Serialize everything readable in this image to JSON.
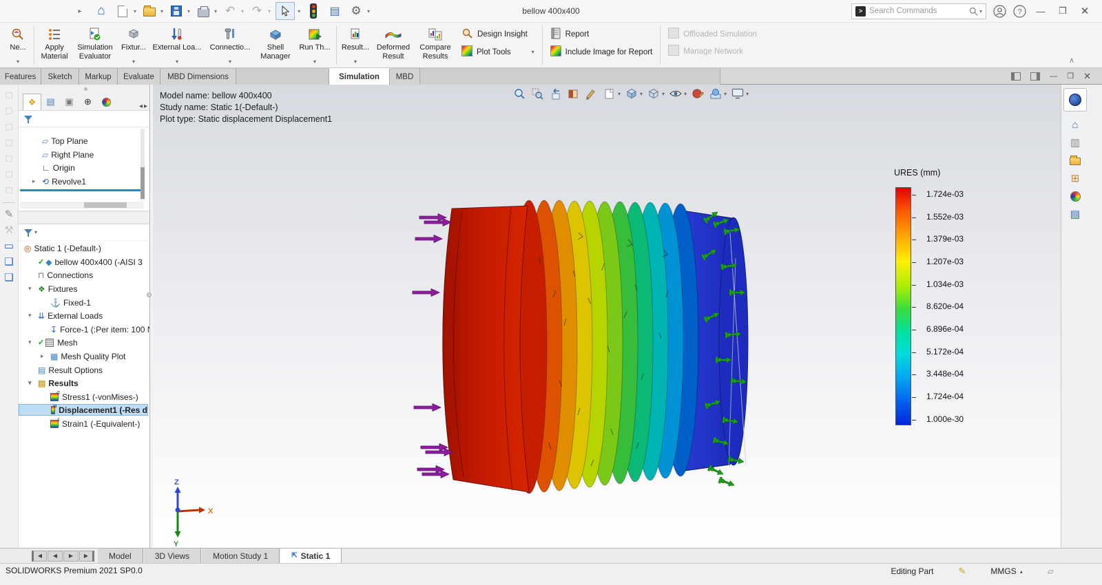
{
  "app": {
    "document_title": "bellow 400x400",
    "search_placeholder": "Search Commands",
    "status_left": "SOLIDWORKS Premium 2021 SP0.0",
    "status_editing": "Editing Part",
    "status_units": "MMGS"
  },
  "ribbon": {
    "new_study": "Ne...",
    "apply_material": "Apply Material",
    "simulation_evaluator": "Simulation Evaluator",
    "fixtures_advisor": "Fixtur...",
    "external_loads_advisor": "External Loa...",
    "connections_advisor": "Connectio...",
    "shell_manager": "Shell Manager",
    "run_study": "Run Th...",
    "results_advisor": "Result...",
    "deformed_result": "Deformed Result",
    "compare_results": "Compare Results",
    "design_insight": "Design Insight",
    "plot_tools": "Plot Tools",
    "report": "Report",
    "include_image": "Include Image for Report",
    "offloaded_simulation": "Offloaded Simulation",
    "manage_network": "Manage Network"
  },
  "cmd_tabs": [
    "Features",
    "Sketch",
    "Markup",
    "Evaluate",
    "MBD Dimensions",
    "Simulation",
    "MBD"
  ],
  "feature_tree": {
    "items": [
      "Top Plane",
      "Right Plane",
      "Origin",
      "Revolve1"
    ]
  },
  "sim_tree": {
    "items": [
      "Static 1 (-Default-)",
      "bellow 400x400 (-AISI 3",
      "Connections",
      "Fixtures",
      "Fixed-1",
      "External Loads",
      "Force-1 (:Per item: 100 N",
      "Mesh",
      "Mesh Quality Plot",
      "Result Options",
      "Results",
      "Stress1 (-vonMises-)",
      "Displacement1 (-Res d",
      "Strain1 (-Equivalent-)"
    ]
  },
  "viewport": {
    "info_line1": "Model name: bellow 400x400",
    "info_line2": "Study name: Static 1(-Default-)",
    "info_line3": "Plot type: Static displacement Displacement1"
  },
  "legend": {
    "title": "URES (mm)",
    "values": [
      "1.724e-03",
      "1.552e-03",
      "1.379e-03",
      "1.207e-03",
      "1.034e-03",
      "8.620e-04",
      "6.896e-04",
      "5.172e-04",
      "3.448e-04",
      "1.724e-04",
      "1.000e-30"
    ],
    "colors_top_to_bottom": [
      "#ff0000",
      "#ff8000",
      "#ffff00",
      "#00ff00",
      "#00ffff",
      "#0000ff"
    ]
  },
  "triad": {
    "x": "X",
    "y": "Y",
    "z": "Z"
  },
  "bottom_tabs": [
    "Model",
    "3D Views",
    "Motion Study 1",
    "Static 1"
  ]
}
